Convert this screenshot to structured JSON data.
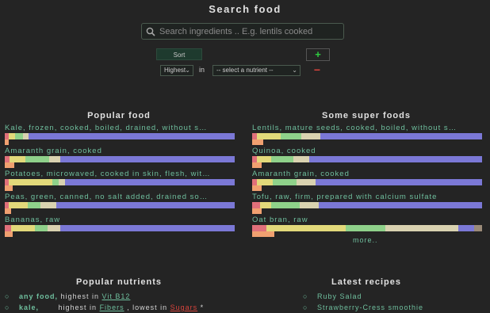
{
  "header": {
    "title": "Search food"
  },
  "search": {
    "placeholder": "Search ingredients .. E.g. lentils cooked",
    "icon": "search-icon"
  },
  "controls": {
    "sort_label": "Sort",
    "add_label": "+",
    "order_value": "Highest",
    "in_label": "in",
    "nutrient_value": "-- select a nutrient --",
    "remove_label": "−"
  },
  "popular_food": {
    "title": "Popular food",
    "items": [
      {
        "label": "Kale, frozen, cooked, boiled, drained, without s…"
      },
      {
        "label": "Amaranth grain, cooked"
      },
      {
        "label": "Potatoes, microwaved, cooked in skin, flesh, wit…"
      },
      {
        "label": "Peas, green, canned, no salt added, drained so…"
      },
      {
        "label": "Bananas, raw"
      }
    ]
  },
  "super_foods": {
    "title": "Some super foods",
    "items": [
      {
        "label": "Lentils, mature seeds, cooked, boiled, without s…"
      },
      {
        "label": "Quinoa, cooked"
      },
      {
        "label": "Amaranth grain, cooked"
      },
      {
        "label": "Tofu, raw, firm, prepared with calcium sulfate"
      },
      {
        "label": "Oat bran, raw"
      }
    ],
    "more_label": "more.."
  },
  "popular_nutrients": {
    "title": "Popular nutrients",
    "items": [
      {
        "bullet": "○",
        "subject": "any food,",
        "t1": " highest in ",
        "link": "Vit B12"
      },
      {
        "bullet": "○",
        "subject": "kale,",
        "t1": "       highest in ",
        "link": "Fibers",
        "t2": " , lowest in ",
        "link2": "Sugars",
        "t3": " *"
      }
    ]
  },
  "latest_recipes": {
    "title": "Latest recipes",
    "items": [
      {
        "bullet": "○",
        "label": "Ruby Salad"
      },
      {
        "bullet": "○",
        "label": "Strawberry-Cress smoothie"
      }
    ]
  },
  "colors": {
    "background": "#242424",
    "accent_green": "#6fbf9e",
    "bar_purple": "#7b78d6",
    "bar_yellow": "#e2d97a",
    "bar_green": "#8fd18a",
    "bar_beige": "#d9d2b0",
    "bar_red": "#e0707a",
    "bar_orange": "#f0a070",
    "remove_red": "#d9443c",
    "add_green": "#2ecc40"
  }
}
